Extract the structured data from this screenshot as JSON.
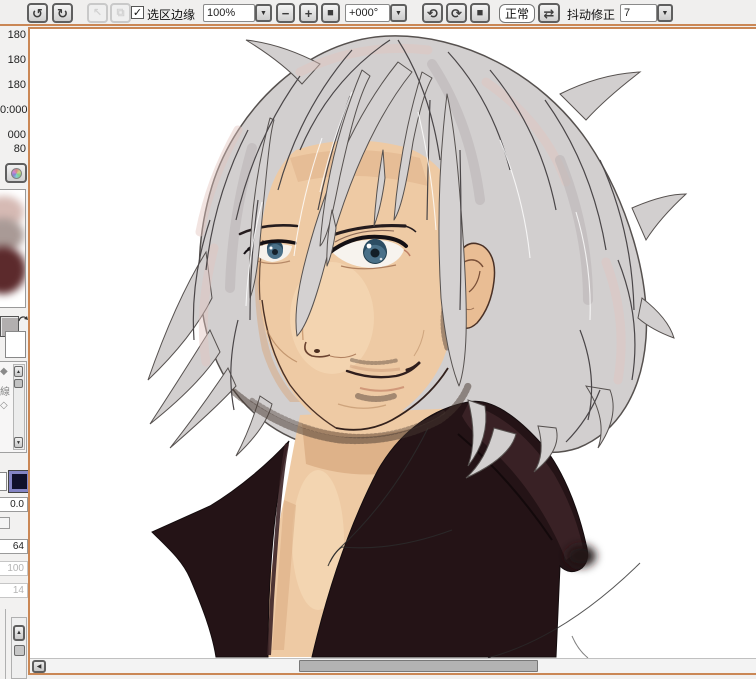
{
  "toolbar": {
    "selection_edge_label": "选区边缘",
    "zoom_value": "100%",
    "angle_value": "+000°",
    "blend_mode_label": "正常",
    "stabilizer_label": "抖动修正",
    "stabilizer_value": "7"
  },
  "icons": {
    "undo": "↺",
    "redo": "↻",
    "deselect": "↖",
    "select_target": "⧉",
    "check": "✓",
    "dropdown": "▼",
    "zoom_out": "−",
    "zoom_in": "+",
    "zoom_reset": "■",
    "rotate_ccw": "⟲",
    "rotate_cw": "⟳",
    "rotate_reset": "■",
    "flip": "⇄",
    "scroll_up": "▲",
    "scroll_down": "▼",
    "scroll_left": "◀"
  },
  "left_panel": {
    "cropped_values": [
      "180",
      "180",
      "180",
      "0:000",
      "000",
      "80"
    ],
    "tool_icons": [
      "◆",
      "線",
      "◇"
    ],
    "param_value_1": "0.0",
    "param_value_2": "64",
    "param_value_3": "100",
    "param_value_4": "14"
  },
  "canvas": {
    "artwork_alt": "Digital painting: man with shaggy silver hair, blue eyes and stubble wearing a dark open-collared coat on a white canvas"
  },
  "palette": {
    "frame_border": "#ca8755",
    "toolbar_bg": "#f0efee",
    "swatch_navy": "#10102a",
    "swatch_navy_border": "#8484c4",
    "hair_silver": "#d2cfcf",
    "hair_tint_pink": "#e3c4be",
    "skin": "#eecaa4",
    "skin_shadow": "#d7a87e",
    "eye_blue": "#4a7088",
    "coat_dark": "#241316",
    "coat_highlight": "#3c2327"
  }
}
